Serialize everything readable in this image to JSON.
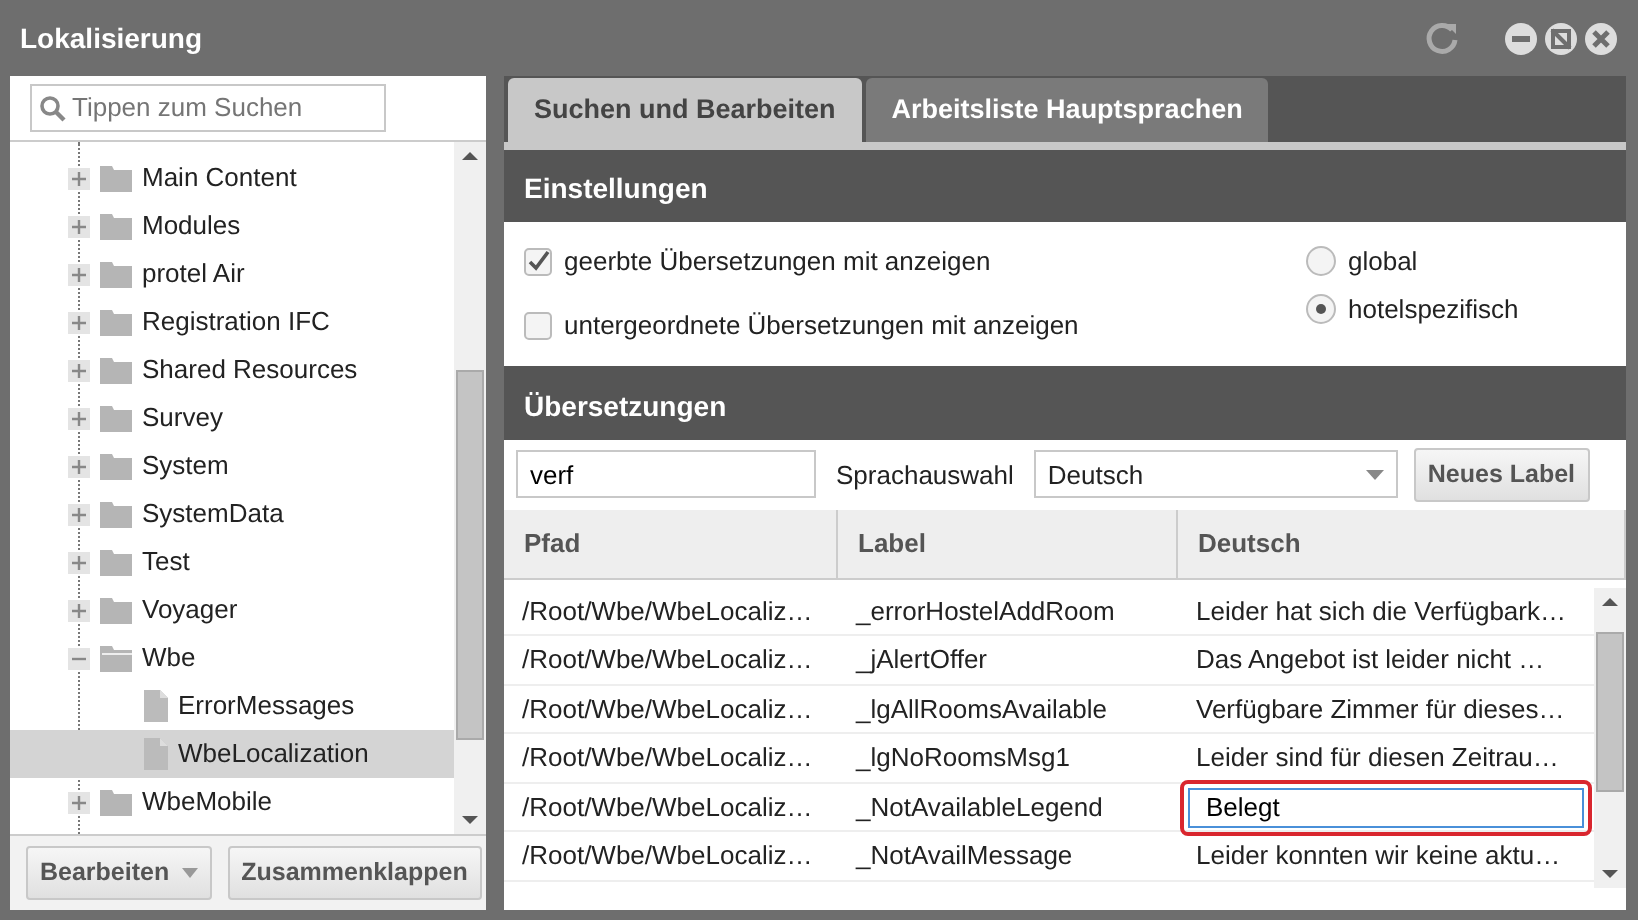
{
  "window": {
    "title": "Lokalisierung"
  },
  "tree": {
    "search": {
      "placeholder": "Tippen zum Suchen"
    },
    "items": [
      {
        "label": "Main Content",
        "expanded": false,
        "selected": false
      },
      {
        "label": "Modules",
        "expanded": false,
        "selected": false
      },
      {
        "label": "protel Air",
        "expanded": false,
        "selected": false
      },
      {
        "label": "Registration IFC",
        "expanded": false,
        "selected": false
      },
      {
        "label": "Shared Resources",
        "expanded": false,
        "selected": false
      },
      {
        "label": "Survey",
        "expanded": false,
        "selected": false
      },
      {
        "label": "System",
        "expanded": false,
        "selected": false
      },
      {
        "label": "SystemData",
        "expanded": false,
        "selected": false
      },
      {
        "label": "Test",
        "expanded": false,
        "selected": false
      },
      {
        "label": "Voyager",
        "expanded": false,
        "selected": false
      },
      {
        "label": "Wbe",
        "expanded": true,
        "selected": false,
        "children": [
          {
            "label": "ErrorMessages",
            "selected": false
          },
          {
            "label": "WbeLocalization",
            "selected": true
          }
        ]
      },
      {
        "label": "WbeMobile",
        "expanded": false,
        "selected": false
      }
    ],
    "buttons": [
      {
        "label": "Bearbeiten",
        "kind": "dropdown"
      },
      {
        "label": "Zusammenklappen",
        "kind": "plain"
      }
    ]
  },
  "tabs": [
    {
      "label": "Suchen und Bearbeiten",
      "selected": true
    },
    {
      "label": "Arbeitsliste Hauptsprachen",
      "selected": false
    }
  ],
  "settings": {
    "title": "Einstellungen",
    "checkboxes": [
      {
        "label": "geerbte Übersetzungen mit anzeigen",
        "checked": true
      },
      {
        "label": "untergeordnete Übersetzungen mit anzeigen",
        "checked": false
      }
    ],
    "radios": [
      {
        "label": "global",
        "selected": false
      },
      {
        "label": "hotelspezifisch",
        "selected": true
      }
    ]
  },
  "translations": {
    "title": "Übersetzungen",
    "search": {
      "value": "verf"
    },
    "language_label": "Sprachauswahl",
    "language": "Deutsch",
    "new_button": "Neues Label",
    "columns": [
      "Pfad",
      "Label",
      "Deutsch"
    ],
    "rows": [
      {
        "path": "/Root/Wbe/WbeLocaliz…",
        "label": "_errorHostelAddRoom",
        "text": "Leider hat sich die Verfügbark…",
        "editing": false
      },
      {
        "path": "/Root/Wbe/WbeLocaliz…",
        "label": "_jAlertOffer",
        "text": "Das Angebot ist leider nicht …",
        "editing": false
      },
      {
        "path": "/Root/Wbe/WbeLocaliz…",
        "label": "_lgAllRoomsAvailable",
        "text": "Verfügbare Zimmer für dieses…",
        "editing": false
      },
      {
        "path": "/Root/Wbe/WbeLocaliz…",
        "label": "_lgNoRoomsMsg1",
        "text": "Leider sind für diesen Zeitrau…",
        "editing": false
      },
      {
        "path": "/Root/Wbe/WbeLocaliz…",
        "label": "_NotAvailableLegend",
        "text": "Belegt",
        "editing": true
      },
      {
        "path": "/Root/Wbe/WbeLocaliz…",
        "label": "_NotAvailMessage",
        "text": "Leider konnten wir keine aktu…",
        "editing": false
      }
    ]
  }
}
